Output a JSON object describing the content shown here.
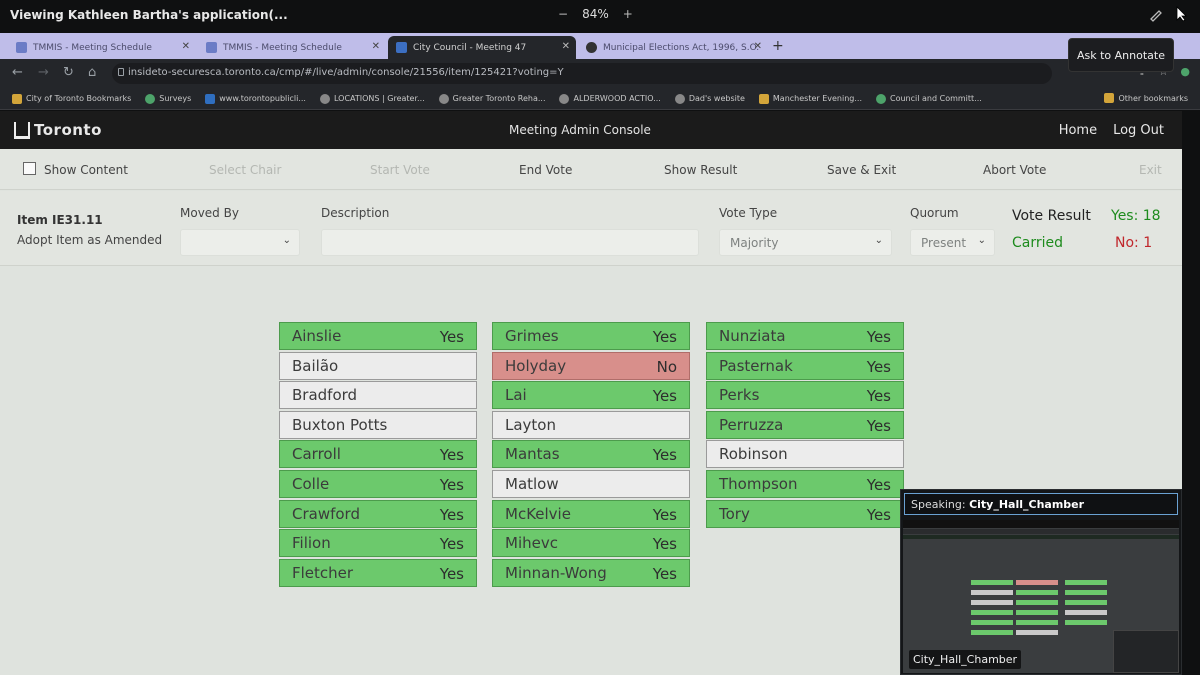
{
  "share": {
    "title": "Viewing Kathleen Bartha's application(...",
    "zoom_minus": "−",
    "zoom_level": "84%",
    "zoom_plus": "+"
  },
  "tabs": [
    {
      "label": "TMMIS - Meeting Schedule"
    },
    {
      "label": "TMMIS - Meeting Schedule"
    },
    {
      "label": "City Council - Meeting 47"
    },
    {
      "label": "Municipal Elections Act, 1996, S.O."
    }
  ],
  "address": {
    "url": "insideto-securesca.toronto.ca/cmp/#/live/admin/console/21556/item/125421?voting=Y"
  },
  "bookmarks": [
    "City of Toronto Bookmarks",
    "Surveys",
    "www.torontopublicli...",
    "LOCATIONS | Greater...",
    "Greater Toronto Reha...",
    "ALDERWOOD ACTIO...",
    "Dad's website",
    "Manchester Evening...",
    "Council and Committ..."
  ],
  "other_bookmarks": "Other bookmarks",
  "annotate_tooltip": "Ask to Annotate",
  "app": {
    "logo": "Toronto",
    "title": "Meeting Admin Console",
    "nav_home": "Home",
    "nav_logout": "Log Out"
  },
  "toolbar": {
    "show_content": "Show Content",
    "select_chair": "Select Chair",
    "start_vote": "Start Vote",
    "end_vote": "End Vote",
    "show_result": "Show Result",
    "save_exit": "Save & Exit",
    "abort_vote": "Abort Vote",
    "exit": "Exit"
  },
  "item": {
    "id": "Item IE31.11",
    "title": "Adopt Item as Amended",
    "moved_by_label": "Moved By",
    "moved_by_value": "",
    "description_label": "Description",
    "description_value": "",
    "vote_type_label": "Vote Type",
    "vote_type_value": "Majority",
    "quorum_label": "Quorum",
    "quorum_value": "Present",
    "vote_result_label": "Vote Result",
    "yes_count": "Yes: 18",
    "no_count": "No: 1",
    "status": "Carried"
  },
  "votes": {
    "col1": [
      {
        "name": "Ainslie",
        "vote": "Yes"
      },
      {
        "name": "Bailão",
        "vote": ""
      },
      {
        "name": "Bradford",
        "vote": ""
      },
      {
        "name": "Buxton Potts",
        "vote": ""
      },
      {
        "name": "Carroll",
        "vote": "Yes"
      },
      {
        "name": "Colle",
        "vote": "Yes"
      },
      {
        "name": "Crawford",
        "vote": "Yes"
      },
      {
        "name": "Filion",
        "vote": "Yes"
      },
      {
        "name": "Fletcher",
        "vote": "Yes"
      }
    ],
    "col2": [
      {
        "name": "Grimes",
        "vote": "Yes"
      },
      {
        "name": "Holyday",
        "vote": "No"
      },
      {
        "name": "Lai",
        "vote": "Yes"
      },
      {
        "name": "Layton",
        "vote": ""
      },
      {
        "name": "Mantas",
        "vote": "Yes"
      },
      {
        "name": "Matlow",
        "vote": ""
      },
      {
        "name": "McKelvie",
        "vote": "Yes"
      },
      {
        "name": "Mihevc",
        "vote": "Yes"
      },
      {
        "name": "Minnan-Wong",
        "vote": "Yes"
      }
    ],
    "col3": [
      {
        "name": "Nunziata",
        "vote": "Yes"
      },
      {
        "name": "Pasternak",
        "vote": "Yes"
      },
      {
        "name": "Perks",
        "vote": "Yes"
      },
      {
        "name": "Perruzza",
        "vote": "Yes"
      },
      {
        "name": "Robinson",
        "vote": ""
      },
      {
        "name": "Thompson",
        "vote": "Yes"
      },
      {
        "name": "Tory",
        "vote": "Yes"
      }
    ]
  },
  "video": {
    "speaking_label": "Speaking:",
    "speaker": "City_Hall_Chamber",
    "tile_label": "City_Hall_Chamber"
  },
  "colors": {
    "yes": "#6cc96c",
    "no": "#d88f8b",
    "none": "#ececec",
    "carried": "#1d8b1d",
    "no_count": "#c0262b"
  }
}
